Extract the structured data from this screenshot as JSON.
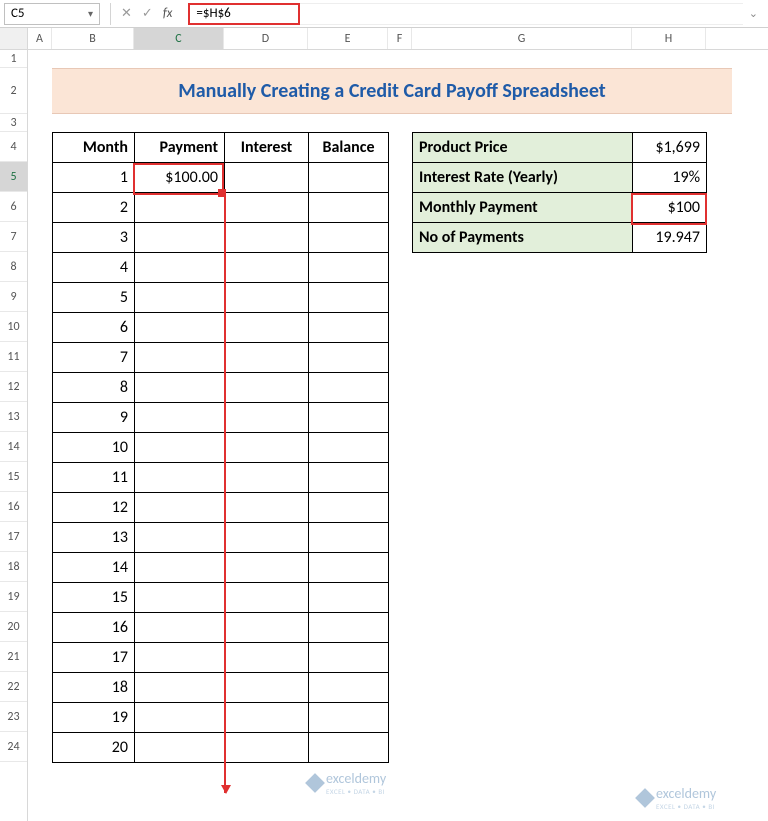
{
  "formula_bar": {
    "cell_ref": "C5",
    "formula": "=$H$6"
  },
  "columns": [
    "A",
    "B",
    "C",
    "D",
    "E",
    "F",
    "G",
    "H"
  ],
  "active_col": "C",
  "active_row": 5,
  "title": "Manually Creating a Credit Card Payoff Spreadsheet",
  "main_headers": {
    "month": "Month",
    "payment": "Payment",
    "interest": "Interest",
    "balance": "Balance"
  },
  "months": [
    "1",
    "2",
    "3",
    "4",
    "5",
    "6",
    "7",
    "8",
    "9",
    "10",
    "11",
    "12",
    "13",
    "14",
    "15",
    "16",
    "17",
    "18",
    "19",
    "20"
  ],
  "payment_c5": "$100.00",
  "side": [
    {
      "label": "Product Price",
      "value": "$1,699",
      "hi": false
    },
    {
      "label": "Interest Rate (Yearly)",
      "value": "19%",
      "hi": false
    },
    {
      "label": "Monthly Payment",
      "value": "$100",
      "hi": true
    },
    {
      "label": "No of Payments",
      "value": "19.947",
      "hi": false
    }
  ],
  "watermark": {
    "brand": "exceldemy",
    "tag": "EXCEL • DATA • BI"
  },
  "chart_data": {
    "type": "table",
    "title": "Manually Creating a Credit Card Payoff Spreadsheet",
    "parameters": {
      "Product Price": 1699,
      "Interest Rate (Yearly)": 0.19,
      "Monthly Payment": 100,
      "No of Payments": 19.947
    },
    "columns": [
      "Month",
      "Payment",
      "Interest",
      "Balance"
    ],
    "rows": [
      {
        "Month": 1,
        "Payment": 100,
        "Interest": null,
        "Balance": null
      },
      {
        "Month": 2,
        "Payment": null,
        "Interest": null,
        "Balance": null
      },
      {
        "Month": 3,
        "Payment": null,
        "Interest": null,
        "Balance": null
      },
      {
        "Month": 4,
        "Payment": null,
        "Interest": null,
        "Balance": null
      },
      {
        "Month": 5,
        "Payment": null,
        "Interest": null,
        "Balance": null
      },
      {
        "Month": 6,
        "Payment": null,
        "Interest": null,
        "Balance": null
      },
      {
        "Month": 7,
        "Payment": null,
        "Interest": null,
        "Balance": null
      },
      {
        "Month": 8,
        "Payment": null,
        "Interest": null,
        "Balance": null
      },
      {
        "Month": 9,
        "Payment": null,
        "Interest": null,
        "Balance": null
      },
      {
        "Month": 10,
        "Payment": null,
        "Interest": null,
        "Balance": null
      },
      {
        "Month": 11,
        "Payment": null,
        "Interest": null,
        "Balance": null
      },
      {
        "Month": 12,
        "Payment": null,
        "Interest": null,
        "Balance": null
      },
      {
        "Month": 13,
        "Payment": null,
        "Interest": null,
        "Balance": null
      },
      {
        "Month": 14,
        "Payment": null,
        "Interest": null,
        "Balance": null
      },
      {
        "Month": 15,
        "Payment": null,
        "Interest": null,
        "Balance": null
      },
      {
        "Month": 16,
        "Payment": null,
        "Interest": null,
        "Balance": null
      },
      {
        "Month": 17,
        "Payment": null,
        "Interest": null,
        "Balance": null
      },
      {
        "Month": 18,
        "Payment": null,
        "Interest": null,
        "Balance": null
      },
      {
        "Month": 19,
        "Payment": null,
        "Interest": null,
        "Balance": null
      },
      {
        "Month": 20,
        "Payment": null,
        "Interest": null,
        "Balance": null
      }
    ],
    "formula_C5": "=$H$6"
  }
}
